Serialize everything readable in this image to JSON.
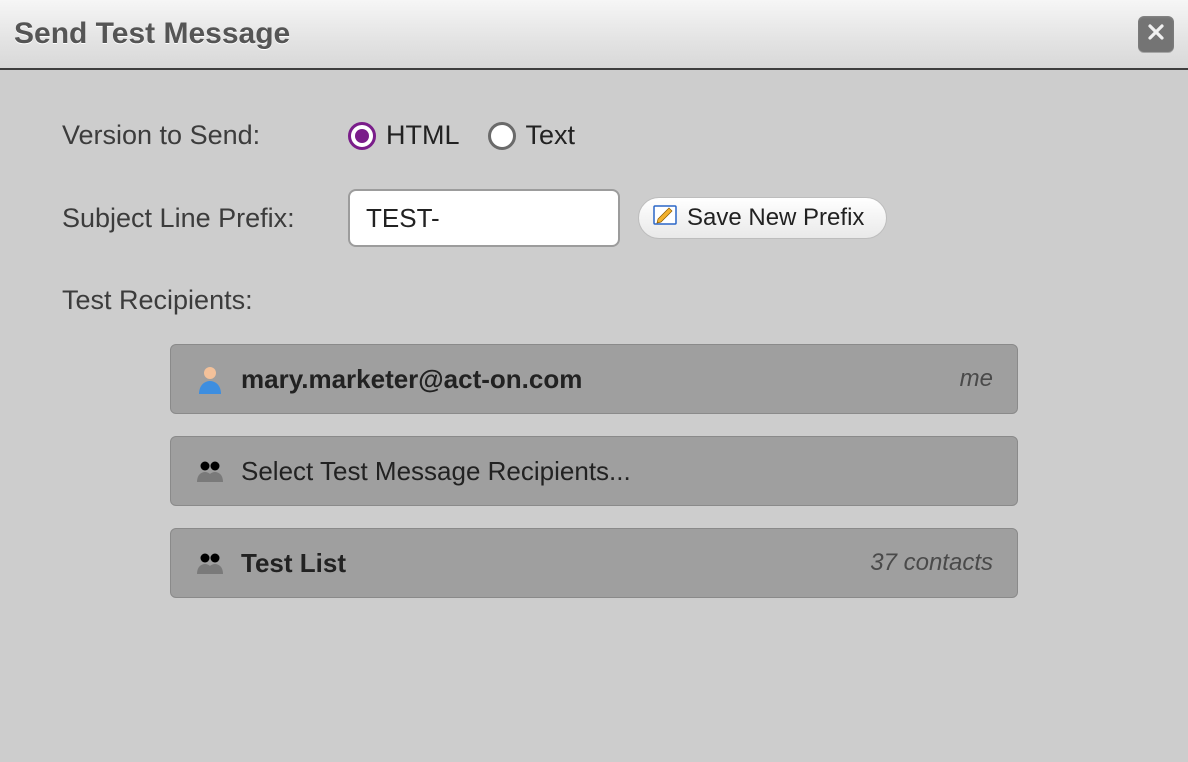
{
  "dialog": {
    "title": "Send Test Message"
  },
  "version": {
    "label": "Version to Send:",
    "options": [
      {
        "label": "HTML",
        "selected": true
      },
      {
        "label": "Text",
        "selected": false
      }
    ]
  },
  "prefix": {
    "label": "Subject Line Prefix:",
    "value": "TEST-",
    "save_label": "Save New Prefix"
  },
  "recipients": {
    "label": "Test Recipients:",
    "items": [
      {
        "icon": "user",
        "text": "mary.marketer@act-on.com",
        "bold": true,
        "right": "me"
      },
      {
        "icon": "group",
        "text": "Select Test Message Recipients...",
        "bold": false,
        "right": ""
      },
      {
        "icon": "group",
        "text": "Test List",
        "bold": true,
        "right": "37 contacts"
      }
    ]
  }
}
